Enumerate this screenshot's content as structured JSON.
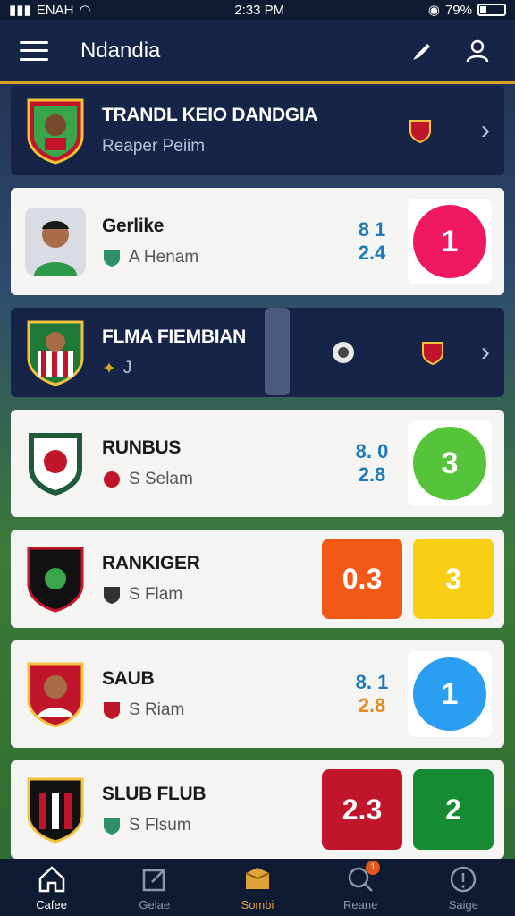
{
  "status": {
    "carrier": "ENAH",
    "time": "2:33 PM",
    "battery": "79%"
  },
  "appbar": {
    "title": "Ndandia"
  },
  "cards": [
    {
      "style": "dark",
      "title": "TRANDL KEIO DANDGIA",
      "subtitle": "Reaper Peiim"
    },
    {
      "style": "light",
      "title": "Gerlike",
      "subtitle": "A Henam",
      "odds_top": "8  1",
      "odds_bottom": "2.4",
      "score": "1",
      "score_color": "#f0185e"
    },
    {
      "style": "dark",
      "title": "FLMA FIEMBIAN",
      "subtitle": "J"
    },
    {
      "style": "light",
      "title": "RUNBUS",
      "subtitle": "S Selam",
      "odds_top": "8. 0",
      "odds_bottom": "2.8",
      "score": "3",
      "score_color": "#56c43a"
    },
    {
      "style": "light",
      "title": "RANKIGER",
      "subtitle": "S Flam",
      "left_box": "0.3",
      "left_color": "#f05a16",
      "right_box": "3",
      "right_color": "#f8cf15"
    },
    {
      "style": "light",
      "title": "SAUB",
      "subtitle": "S Riam",
      "odds_top": "8. 1",
      "odds_bottom": "2.8",
      "score": "1",
      "score_color": "#2a9ef0"
    },
    {
      "style": "light",
      "title": "SLUB FLUB",
      "subtitle": "S Flsum",
      "left_box": "2.3",
      "left_color": "#c0152a",
      "right_box": "2",
      "right_color": "#178a34"
    }
  ],
  "nav": [
    {
      "label": "Cafee",
      "icon": "home-icon"
    },
    {
      "label": "Gelae",
      "icon": "edit-icon"
    },
    {
      "label": "Sombi",
      "icon": "box-icon"
    },
    {
      "label": "Reane",
      "icon": "search-icon",
      "badge": "1"
    },
    {
      "label": "Saige",
      "icon": "info-icon"
    }
  ]
}
